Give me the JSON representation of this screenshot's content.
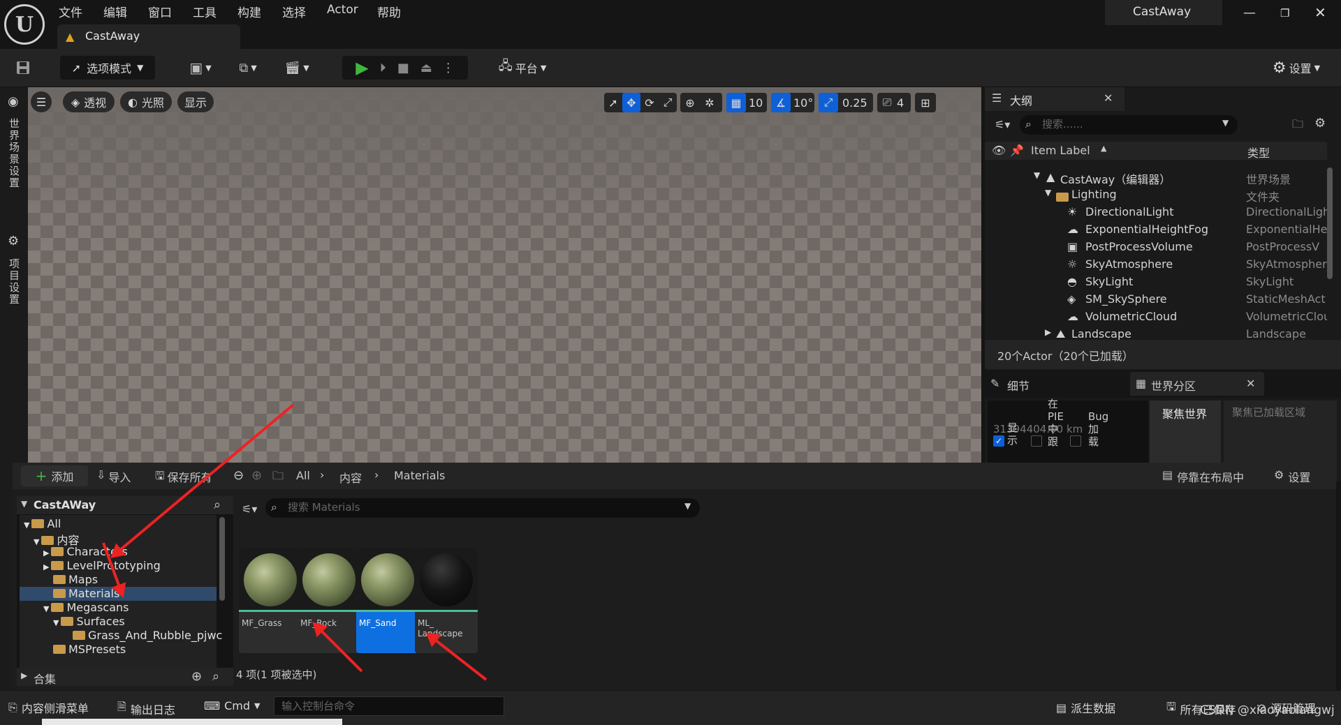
{
  "menu": [
    "文件",
    "编辑",
    "窗口",
    "工具",
    "构建",
    "选择",
    "Actor",
    "帮助"
  ],
  "tab": {
    "title": "CastAway"
  },
  "window": {
    "project": "CastAway"
  },
  "toolbar": {
    "mode": "选项模式",
    "platform": "平台",
    "settings": "设置"
  },
  "left_strip": {
    "world_settings": "世界场景设置",
    "project_settings": "项目设置"
  },
  "viewport": {
    "perspective": "透视",
    "lighting": "光照",
    "show": "显示",
    "grid_snap": "10",
    "rot_snap": "10°",
    "scale_snap": "0.25",
    "camera_speed": "4"
  },
  "outliner": {
    "title": "大纲",
    "search_placeholder": "搜索......",
    "col_label": "Item Label",
    "col_type": "类型",
    "rows": [
      {
        "label": "CastAway（编辑器）",
        "type": "世界场景"
      },
      {
        "label": "Lighting",
        "type": "文件夹"
      },
      {
        "label": "DirectionalLight",
        "type": "DirectionalLigh"
      },
      {
        "label": "ExponentialHeightFog",
        "type": "ExponentialHe"
      },
      {
        "label": "PostProcessVolume",
        "type": "PostProcessV"
      },
      {
        "label": "SkyAtmosphere",
        "type": "SkyAtmospher"
      },
      {
        "label": "SkyLight",
        "type": "SkyLight"
      },
      {
        "label": "SM_SkySphere",
        "type": "StaticMeshAct"
      },
      {
        "label": "VolumetricCloud",
        "type": "VolumetricClou"
      },
      {
        "label": "Landscape",
        "type": "Landscape"
      }
    ],
    "footer": "20个Actor（20个已加载）"
  },
  "details": {
    "tab_details": "细节",
    "tab_world_partition": "世界分区",
    "focus_world": "聚焦世界",
    "focus_loaded": "聚焦已加载区域",
    "col_show": "显\n示",
    "col_pie": "在\nPIE\n中\n跟",
    "col_bug": "Bug\n加\n载",
    "value": "31394404.00 km"
  },
  "content_browser": {
    "add": "添加",
    "import": "导入",
    "save_all": "保存所有",
    "path": [
      "All",
      "内容",
      "Materials"
    ],
    "dock": "停靠在布局中",
    "settings": "设置",
    "tree_title": "CastAWay",
    "tree": [
      {
        "label": "All",
        "indent": 1,
        "open": true
      },
      {
        "label": "内容",
        "indent": 2,
        "open": true
      },
      {
        "label": "Characters",
        "indent": 3,
        "open": false
      },
      {
        "label": "LevelPrototyping",
        "indent": 3,
        "open": false
      },
      {
        "label": "Maps",
        "indent": 3
      },
      {
        "label": "Materials",
        "indent": 3,
        "selected": true
      },
      {
        "label": "Megascans",
        "indent": 3,
        "open": true
      },
      {
        "label": "Surfaces",
        "indent": 4,
        "open": true
      },
      {
        "label": "Grass_And_Rubble_pjwc",
        "indent": 5
      },
      {
        "label": "MSPresets",
        "indent": 3
      }
    ],
    "collections": "合集",
    "search_placeholder": "搜索 Materials",
    "assets": [
      {
        "name": "MF_Grass",
        "kind": "grass"
      },
      {
        "name": "MF_Rock",
        "kind": "grass"
      },
      {
        "name": "MF_Sand",
        "kind": "grass",
        "selected": true
      },
      {
        "name": "ML_\nLandscape",
        "kind": "dark"
      }
    ],
    "count": "4 项(1 项被选中)"
  },
  "statusbar": {
    "drawer": "内容侧滑菜单",
    "log": "输出日志",
    "cmd": "Cmd",
    "cmd_placeholder": "输入控制台命令",
    "derived": "派生数据",
    "saved": "所有已保存",
    "source": "源码管理"
  },
  "watermark": "CSDN @xiaoyaolangwj",
  "colors": {
    "accent": "#0e70e0",
    "annotation": "#ee2222",
    "play": "#3db83d"
  }
}
